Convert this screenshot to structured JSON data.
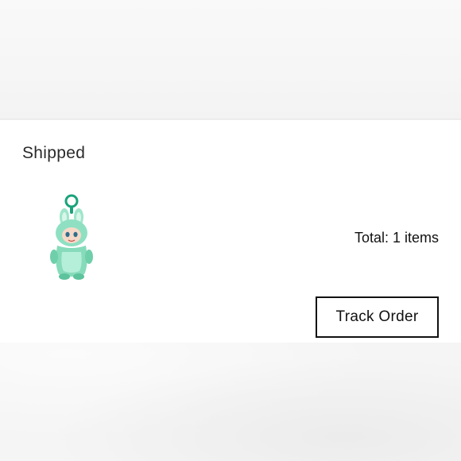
{
  "order": {
    "status": "Shipped",
    "total_label": "Total: 1 items",
    "track_button_label": "Track Order",
    "item_count": 1
  },
  "product": {
    "thumbnail_icon": "plush-keychain-icon",
    "colors": {
      "body": "#8fe0c2",
      "ring": "#1aa37a"
    }
  },
  "colors": {
    "background": "#f7f7f7",
    "card": "#ffffff",
    "text": "#111111",
    "button_border": "#111111"
  }
}
